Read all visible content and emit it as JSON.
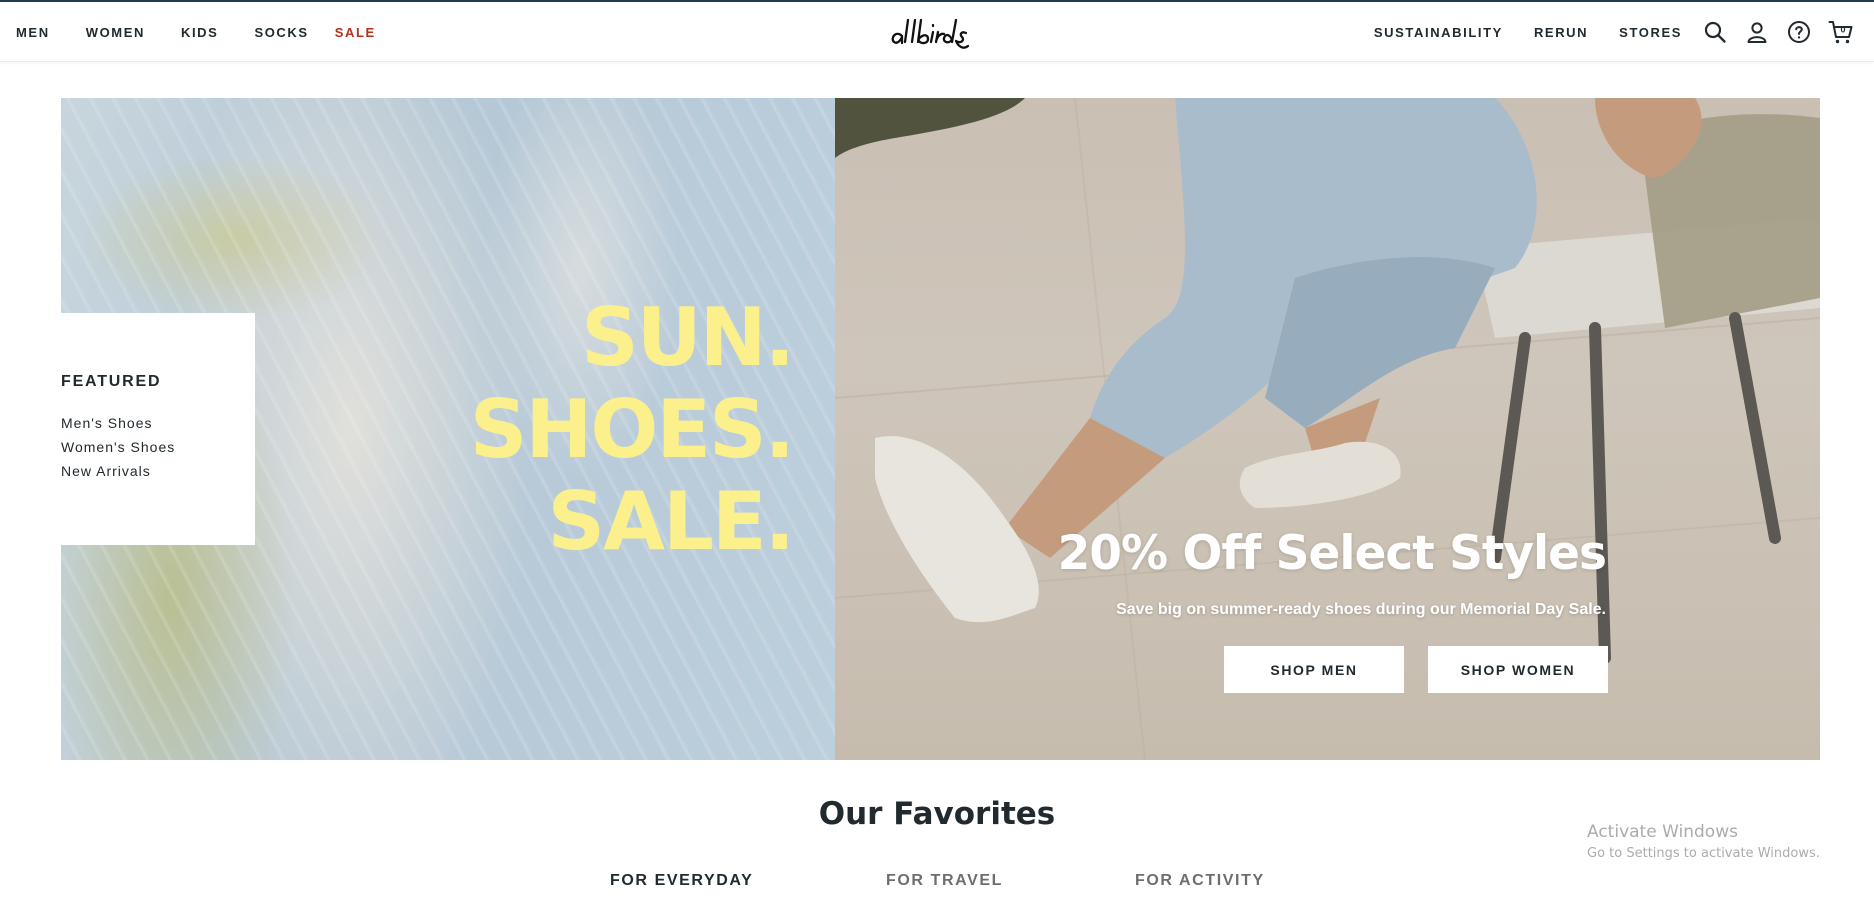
{
  "nav": {
    "left": [
      {
        "label": "MEN"
      },
      {
        "label": "WOMEN"
      },
      {
        "label": "KIDS"
      },
      {
        "label": "SOCKS"
      },
      {
        "label": "SALE",
        "color": "#b6311d"
      }
    ],
    "logo_text": "allbirds",
    "right": [
      {
        "label": "SUSTAINABILITY"
      },
      {
        "label": "RERUN"
      },
      {
        "label": "STORES"
      }
    ],
    "icons": [
      "search-icon",
      "account-icon",
      "help-icon",
      "cart-icon"
    ],
    "cart_count": "0"
  },
  "hero": {
    "headline": [
      "SUN.",
      "SHOES.",
      "SALE."
    ],
    "headline_color": "#fcf08c",
    "featured": {
      "title": "FEATURED",
      "links": [
        "Men's Shoes",
        "Women's Shoes",
        "New Arrivals"
      ]
    },
    "promo_title": "20% Off Select Styles",
    "promo_subtitle": "Save big on summer-ready shoes during our Memorial Day Sale.",
    "buttons": [
      "SHOP MEN",
      "SHOP WOMEN"
    ]
  },
  "favorites": {
    "title": "Our Favorites",
    "tabs": [
      "FOR EVERYDAY",
      "FOR TRAVEL",
      "FOR ACTIVITY"
    ],
    "active_tab": "FOR EVERYDAY"
  },
  "watermark": {
    "line1": "Activate Windows",
    "line2": "Go to Settings to activate Windows."
  },
  "colors": {
    "text": "#212a2f",
    "sale": "#b6311d",
    "hero_blue": "#b9cbd9"
  }
}
